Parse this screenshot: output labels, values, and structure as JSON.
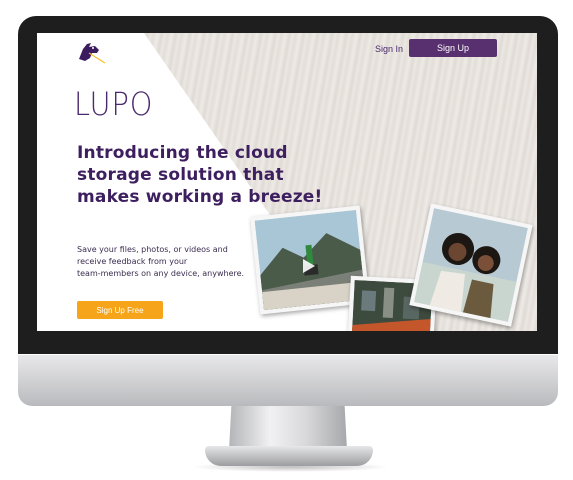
{
  "header": {
    "signin_label": "Sign In",
    "signup_label": "Sign Up"
  },
  "hero": {
    "brand": "LUPO",
    "headline": "Introducing the cloud storage solution that makes working a breeze!",
    "body_lines": [
      "Save your files, photos, or videos and",
      "receive feedback from your",
      "team-members on any device, anywhere."
    ],
    "cta_label": "Sign Up Free"
  },
  "colors": {
    "brand_purple": "#58306f",
    "cta_orange": "#f6a51a",
    "bezel": "#1e1e1f"
  },
  "icons": {
    "logo": "horse-head-logo-icon",
    "play": "play-icon"
  }
}
